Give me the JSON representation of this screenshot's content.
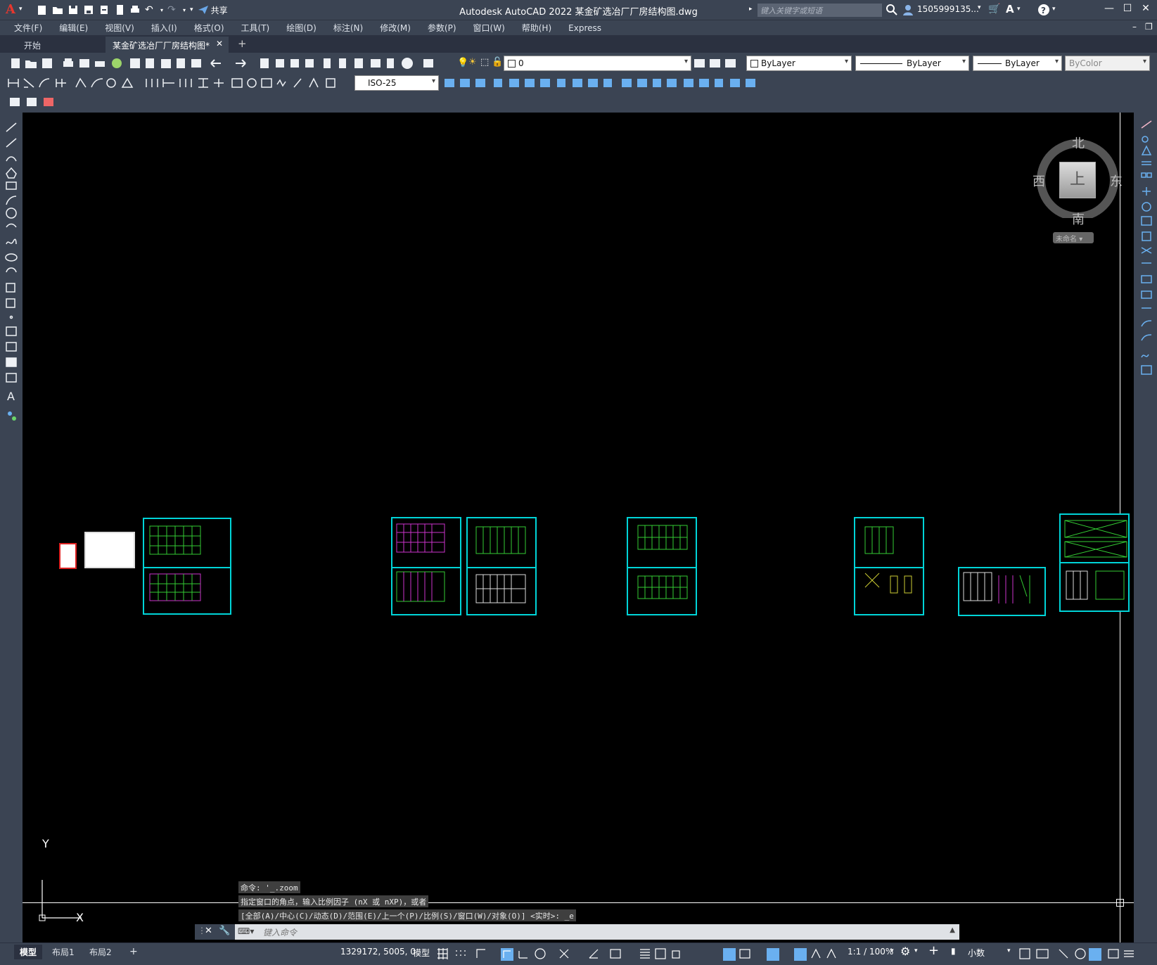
{
  "app": {
    "title": "Autodesk AutoCAD 2022    某金矿选冶厂厂房结构图.dwg",
    "share_label": "共享",
    "search_placeholder": "键入关键字或短语",
    "user": "1505999135...",
    "logo": "A"
  },
  "menu": [
    "文件(F)",
    "编辑(E)",
    "视图(V)",
    "插入(I)",
    "格式(O)",
    "工具(T)",
    "绘图(D)",
    "标注(N)",
    "修改(M)",
    "参数(P)",
    "窗口(W)",
    "帮助(H)",
    "Express"
  ],
  "tabs": {
    "start": "开始",
    "document": "某金矿选冶厂厂房结构图*"
  },
  "properties": {
    "layer": "0",
    "color": "ByLayer",
    "linetype": "ByLayer",
    "lineweight": "ByLayer",
    "plotstyle": "ByColor",
    "dimstyle": "ISO-25"
  },
  "viewcube": {
    "north": "北",
    "south": "南",
    "east": "东",
    "west": "西",
    "face": "上",
    "wcs": "未命名"
  },
  "ucs": {
    "x": "X",
    "y": "Y"
  },
  "command_history": [
    "命令: '_.zoom",
    "指定窗口的角点，输入比例因子 (nX 或 nXP)，或者",
    "[全部(A)/中心(C)/动态(D)/范围(E)/上一个(P)/比例(S)/窗口(W)/对象(O)] <实时>: _e"
  ],
  "command_placeholder": "键入命令",
  "layout_tabs": [
    "模型",
    "布局1",
    "布局2"
  ],
  "status": {
    "coords": "1329172, 5005, 0",
    "model": "模型",
    "scale": "1:1 / 100%",
    "units": "小数"
  },
  "colors": {
    "sheet_border": "#00d4d8",
    "ui_bg": "#3b4453",
    "canvas_bg": "#000000"
  }
}
